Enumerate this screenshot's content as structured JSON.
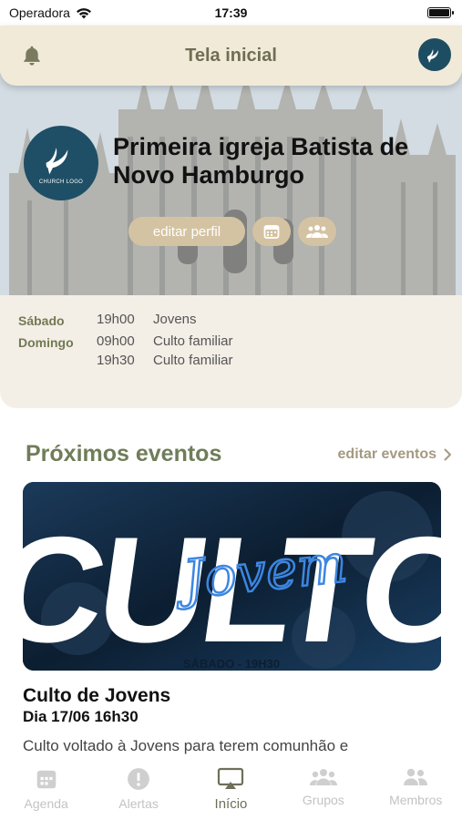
{
  "status_bar": {
    "carrier": "Operadora",
    "time": "17:39"
  },
  "header": {
    "title": "Tela inicial"
  },
  "profile": {
    "name": "Primeira igreja Batista de Novo Hamburgo",
    "logo_text": "CHURCH LOGO",
    "edit_label": "editar perfil"
  },
  "schedule": {
    "days": [
      {
        "day": "Sábado",
        "items": [
          {
            "time": "19h00",
            "label": "Jovens"
          }
        ]
      },
      {
        "day": "Domingo",
        "items": [
          {
            "time": "09h00",
            "label": "Culto familiar"
          },
          {
            "time": "19h30",
            "label": "Culto familiar"
          }
        ]
      }
    ]
  },
  "events": {
    "section_title": "Próximos eventos",
    "edit_label": "editar eventos",
    "featured": {
      "banner_word": "CULTO",
      "banner_script": "Jovem",
      "banner_sub": "SÁBADO - 19H30",
      "title": "Culto de Jovens",
      "date": "Dia 17/06 16h30",
      "description": "Culto voltado à Jovens para terem comunhão e"
    }
  },
  "tabs": [
    {
      "label": "Agenda",
      "icon": "calendar-icon",
      "active": false
    },
    {
      "label": "Alertas",
      "icon": "alert-icon",
      "active": false
    },
    {
      "label": "Início",
      "icon": "home-screen-icon",
      "active": true
    },
    {
      "label": "Grupos",
      "icon": "groups-icon",
      "active": false
    },
    {
      "label": "Membros",
      "icon": "members-icon",
      "active": false
    }
  ],
  "colors": {
    "header_bg": "#f1ead8",
    "accent_olive": "#6f7d59",
    "pill_tan": "#d4c3a2",
    "logo_blue": "#1e4f66"
  }
}
